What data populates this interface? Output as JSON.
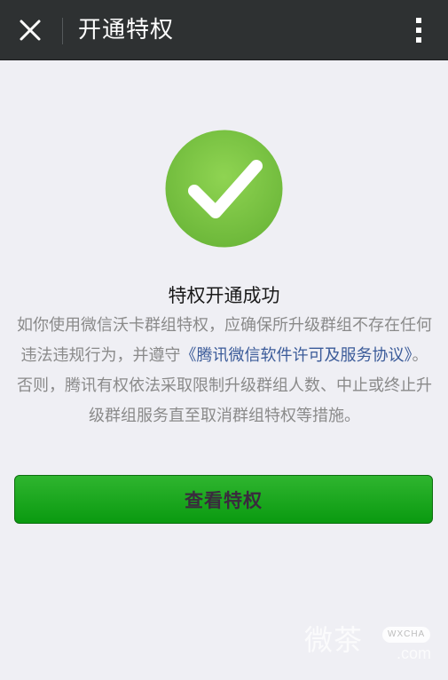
{
  "header": {
    "title": "开通特权",
    "close_icon": "close-icon",
    "more_icon": "more-vertical-icon"
  },
  "result": {
    "icon": "check-circle-icon",
    "icon_color": "#7fc843",
    "title": "特权开通成功"
  },
  "notice": {
    "text_before": "如你使用微信沃卡群组特权，应确保所升级群组不存在任何违法违规行为，并遵守",
    "link": "《腾讯微信软件许可及服务协议》",
    "text_after": "。否则，腾讯有权依法采取限制升级群组人数、中止或终止升级群组服务直至取消群组特权等措施。"
  },
  "actions": {
    "view_label": "查看特权",
    "button_color": "#1ea51f"
  },
  "watermark": {
    "logo_text": "微茶",
    "badge": "WXCHA",
    "domain": ".com"
  },
  "colors": {
    "topbar": "#2e3132",
    "background": "#efeff4",
    "link": "#3b5b99"
  }
}
